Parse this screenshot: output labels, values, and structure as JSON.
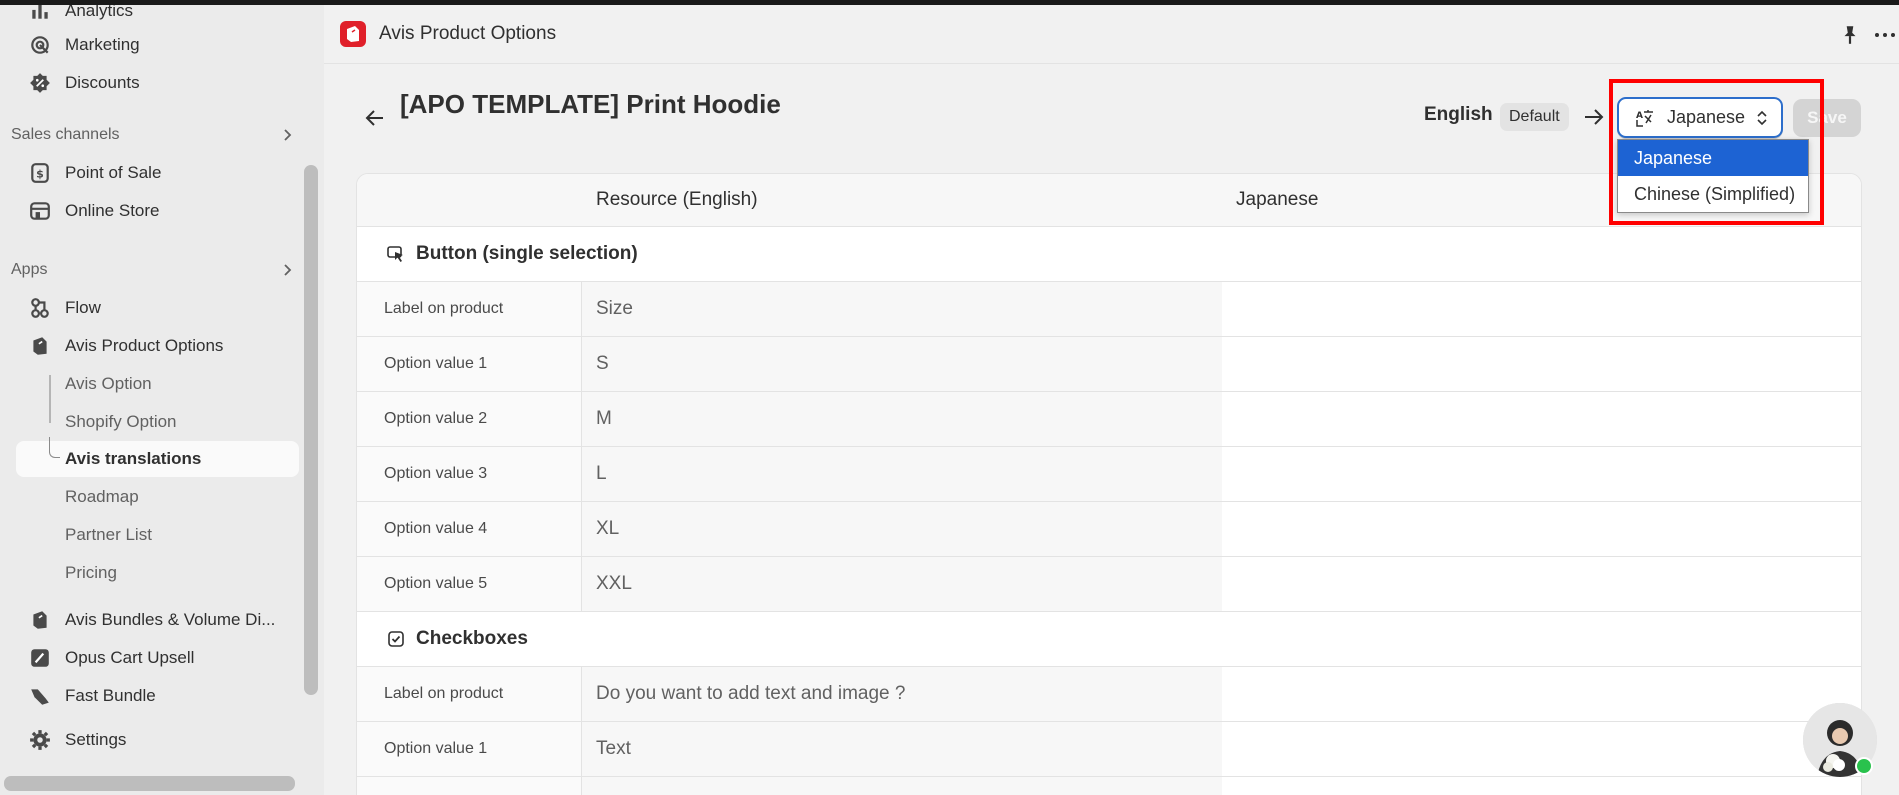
{
  "sidebar": {
    "items_top": [
      {
        "label": "Analytics",
        "icon": "bar-chart-icon"
      },
      {
        "label": "Marketing",
        "icon": "target-icon"
      },
      {
        "label": "Discounts",
        "icon": "discount-icon"
      }
    ],
    "sales_channels_label": "Sales channels",
    "sales_channels": [
      {
        "label": "Point of Sale",
        "icon": "pos-icon"
      },
      {
        "label": "Online Store",
        "icon": "store-icon"
      }
    ],
    "apps_label": "Apps",
    "apps": [
      {
        "label": "Flow",
        "icon": "flow-icon"
      },
      {
        "label": "Avis Product Options",
        "icon": "avis-app-icon"
      }
    ],
    "sub_items": [
      {
        "label": "Avis Option"
      },
      {
        "label": "Shopify Option"
      },
      {
        "label": "Avis translations"
      },
      {
        "label": "Roadmap"
      },
      {
        "label": "Partner List"
      },
      {
        "label": "Pricing"
      }
    ],
    "apps_more": [
      {
        "label": "Avis Bundles & Volume Di..."
      },
      {
        "label": "Opus Cart Upsell"
      },
      {
        "label": "Fast Bundle"
      }
    ],
    "settings_label": "Settings"
  },
  "header": {
    "app_title": "Avis Product Options"
  },
  "page": {
    "title": "[APO TEMPLATE] Print Hoodie",
    "source_language": "English",
    "default_badge": "Default",
    "selected_language": "Japanese",
    "save_label": "Save",
    "dropdown_options": [
      "Japanese",
      "Chinese (Simplified)"
    ]
  },
  "table": {
    "col_resource": "Resource (English)",
    "col_target": "Japanese",
    "groups": [
      {
        "title": "Button (single selection)",
        "rows": [
          {
            "label": "Label on product",
            "value": "Size"
          },
          {
            "label": "Option value 1",
            "value": "S"
          },
          {
            "label": "Option value 2",
            "value": "M"
          },
          {
            "label": "Option value 3",
            "value": "L"
          },
          {
            "label": "Option value 4",
            "value": "XL"
          },
          {
            "label": "Option value 5",
            "value": "XXL"
          }
        ]
      },
      {
        "title": "Checkboxes",
        "rows": [
          {
            "label": "Label on product",
            "value": "Do you want to add text and image ?"
          },
          {
            "label": "Option value 1",
            "value": "Text"
          }
        ]
      }
    ]
  },
  "colors": {
    "accent_blue": "#1d63d3",
    "highlight_red": "#ff0000",
    "app_brand_red": "#e0202a"
  }
}
